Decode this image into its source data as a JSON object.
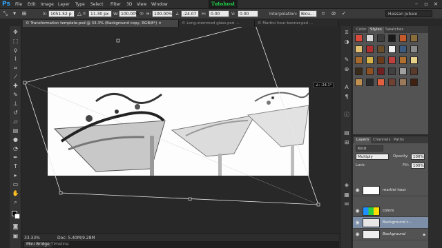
{
  "app": {
    "logo": "Ps",
    "brand": "Tutohost"
  },
  "menu": [
    "File",
    "Edit",
    "Image",
    "Layer",
    "Type",
    "Select",
    "Filter",
    "3D",
    "View",
    "Window"
  ],
  "options_bar": {
    "x_label": "X:",
    "x_value": "1051.52 p",
    "y_label": "Y:",
    "y_value": "11.30 px",
    "w_label": "W:",
    "w_value": "100.00%",
    "h_label": "H:",
    "h_value": "100.00%",
    "angle_label": "∠",
    "angle_value": "-24.07",
    "hskew_label": "H:",
    "hskew_value": "0.00",
    "vskew_label": "V:",
    "vskew_value": "0.00",
    "interp_label": "Interpolation:",
    "interp_value": "Bicu...",
    "workspace_name": "Hassan Jubaie"
  },
  "tabs": [
    {
      "label": "© Transformation template.psd @ 33.3% (Background copy, RGB/8*) ×",
      "active": true
    },
    {
      "label": "© Long-stemmed glass.psd ...",
      "active": false
    },
    {
      "label": "© Martini hour banner.psd ...",
      "active": false
    }
  ],
  "canvas": {
    "angle_readout": "∠: -24.1°"
  },
  "status": {
    "zoom": "33.33%",
    "doc": "Doc: 5.40M/9.28M"
  },
  "bottom_tabs": [
    "Mini Bridge",
    "Timeline"
  ],
  "styles_panel": {
    "tabs": [
      "Color",
      "Styles",
      "Swatches"
    ],
    "swatches": [
      "#d94a3a",
      "#d9d9d9",
      "#3b3b3b",
      "#1a1a1a",
      "#c45a2b",
      "#8a6d3b",
      "#e0c070",
      "#b03030",
      "#6b4f2a",
      "#f2f2f2",
      "#3d5a80",
      "#8b8b8b",
      "#a86a2c",
      "#d6b44a",
      "#6a3a1a",
      "#c04040",
      "#b07030",
      "#e8d28a",
      "#3a2a1a",
      "#905020",
      "#702020",
      "#404040",
      "#a0a0a0",
      "#5a3a2a",
      "#c09050",
      "#2a2a2a",
      "#e06040",
      "#704030",
      "#9a7a5a",
      "#402010"
    ]
  },
  "layers_panel": {
    "tabs": [
      "Layers",
      "Channels",
      "Paths"
    ],
    "filter_label": "Kind",
    "blend_mode": "Multiply",
    "opacity_label": "Opacity:",
    "opacity_value": "100%",
    "lock_label": "Lock:",
    "fill_label": "Fill:",
    "fill_value": "100%",
    "layers": [
      {
        "name": "martini hour",
        "active": false,
        "italic": false
      },
      {
        "name": "colors",
        "active": false,
        "italic": false
      },
      {
        "name": "Background c...",
        "active": true,
        "italic": false
      },
      {
        "name": "Background",
        "active": false,
        "italic": true
      }
    ]
  },
  "colors": {
    "accent": "#31a8ff",
    "brand": "#22d34a",
    "selected_layer": "#7d8fa8"
  }
}
